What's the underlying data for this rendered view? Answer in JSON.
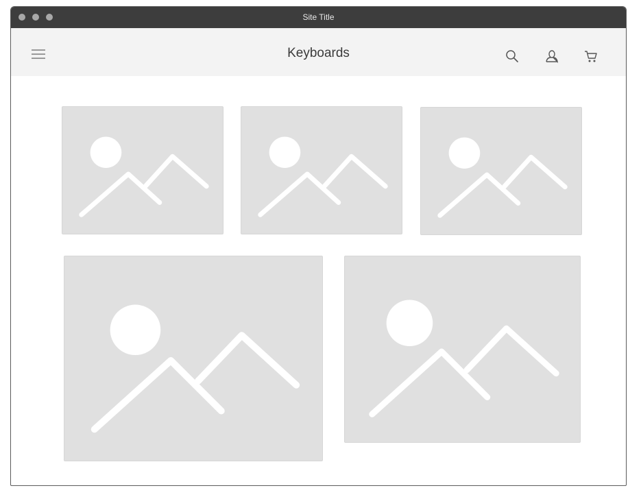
{
  "window": {
    "title": "Site Title"
  },
  "header": {
    "page_title": "Keyboards",
    "icons": [
      "menu-icon",
      "search-icon",
      "user-icon",
      "cart-icon"
    ]
  },
  "gallery": {
    "items": [
      {
        "name": "image-placeholder-1"
      },
      {
        "name": "image-placeholder-2"
      },
      {
        "name": "image-placeholder-3"
      },
      {
        "name": "image-placeholder-4"
      },
      {
        "name": "image-placeholder-5"
      }
    ]
  },
  "colors": {
    "titlebar": "#3d3d3d",
    "navbar": "#f3f3f3",
    "placeholder": "#e0e0e0",
    "placeholder_mark": "#ffffff"
  }
}
